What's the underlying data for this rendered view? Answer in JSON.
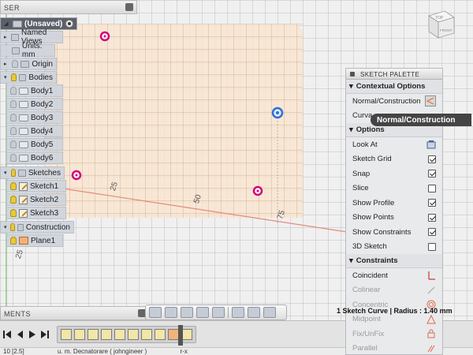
{
  "browser": {
    "header": "SER",
    "items": [
      {
        "label": "(Unsaved)",
        "kind": "root"
      },
      {
        "label": "Named Views",
        "kind": "folder"
      },
      {
        "label": "Units: mm",
        "kind": "units"
      },
      {
        "label": "Origin",
        "kind": "folder"
      },
      {
        "label": "Bodies",
        "kind": "folder"
      },
      {
        "label": "Body1",
        "kind": "body"
      },
      {
        "label": "Body2",
        "kind": "body"
      },
      {
        "label": "Body3",
        "kind": "body"
      },
      {
        "label": "Body4",
        "kind": "body"
      },
      {
        "label": "Body5",
        "kind": "body"
      },
      {
        "label": "Body6",
        "kind": "body"
      },
      {
        "label": "Sketches",
        "kind": "folder"
      },
      {
        "label": "Sketch1",
        "kind": "sketch"
      },
      {
        "label": "Sketch2",
        "kind": "sketch"
      },
      {
        "label": "Sketch3",
        "kind": "sketch"
      },
      {
        "label": "Construction",
        "kind": "folder"
      },
      {
        "label": "Plane1",
        "kind": "plane"
      }
    ]
  },
  "viewport": {
    "axis_labels": [
      "25",
      "50",
      "75",
      "25"
    ],
    "viewcube": {
      "top": "TOP",
      "front": "FRONT"
    }
  },
  "palette": {
    "title": "SKETCH PALETTE",
    "contextual_header": "Contextual Options",
    "normal_construction_label": "Normal/Construction",
    "curvature_label": "Curva",
    "options_header": "Options",
    "options": [
      {
        "label": "Look At",
        "control": "icon"
      },
      {
        "label": "Sketch Grid",
        "control": "checkbox",
        "checked": true
      },
      {
        "label": "Snap",
        "control": "checkbox",
        "checked": true
      },
      {
        "label": "Slice",
        "control": "checkbox",
        "checked": false
      },
      {
        "label": "Show Profile",
        "control": "checkbox",
        "checked": true
      },
      {
        "label": "Show Points",
        "control": "checkbox",
        "checked": true
      },
      {
        "label": "Show Constraints",
        "control": "checkbox",
        "checked": true
      },
      {
        "label": "3D Sketch",
        "control": "checkbox",
        "checked": false
      }
    ],
    "constraints_header": "Constraints",
    "constraints": [
      {
        "label": "Coincident",
        "enabled": true
      },
      {
        "label": "Colinear",
        "enabled": false
      },
      {
        "label": "Concentric",
        "enabled": false
      },
      {
        "label": "Midpoint",
        "enabled": false
      },
      {
        "label": "Fix/UnFix",
        "enabled": false
      },
      {
        "label": "Parallel",
        "enabled": false
      }
    ]
  },
  "tooltip": "Normal/Construction",
  "status_overlay": "1 Sketch Curve | Radius : 1.40 mm",
  "comments_bar": "MENTS",
  "status_strip": [
    "10 [2.5]",
    "u. m. Decnatorare ( johngineer )",
    "r-x"
  ],
  "colors": {
    "accent": "#e06a4a",
    "sketch_plane": "#f9e4cd",
    "point_magenta": "#d1007a",
    "point_blue": "#2c6fd8"
  }
}
